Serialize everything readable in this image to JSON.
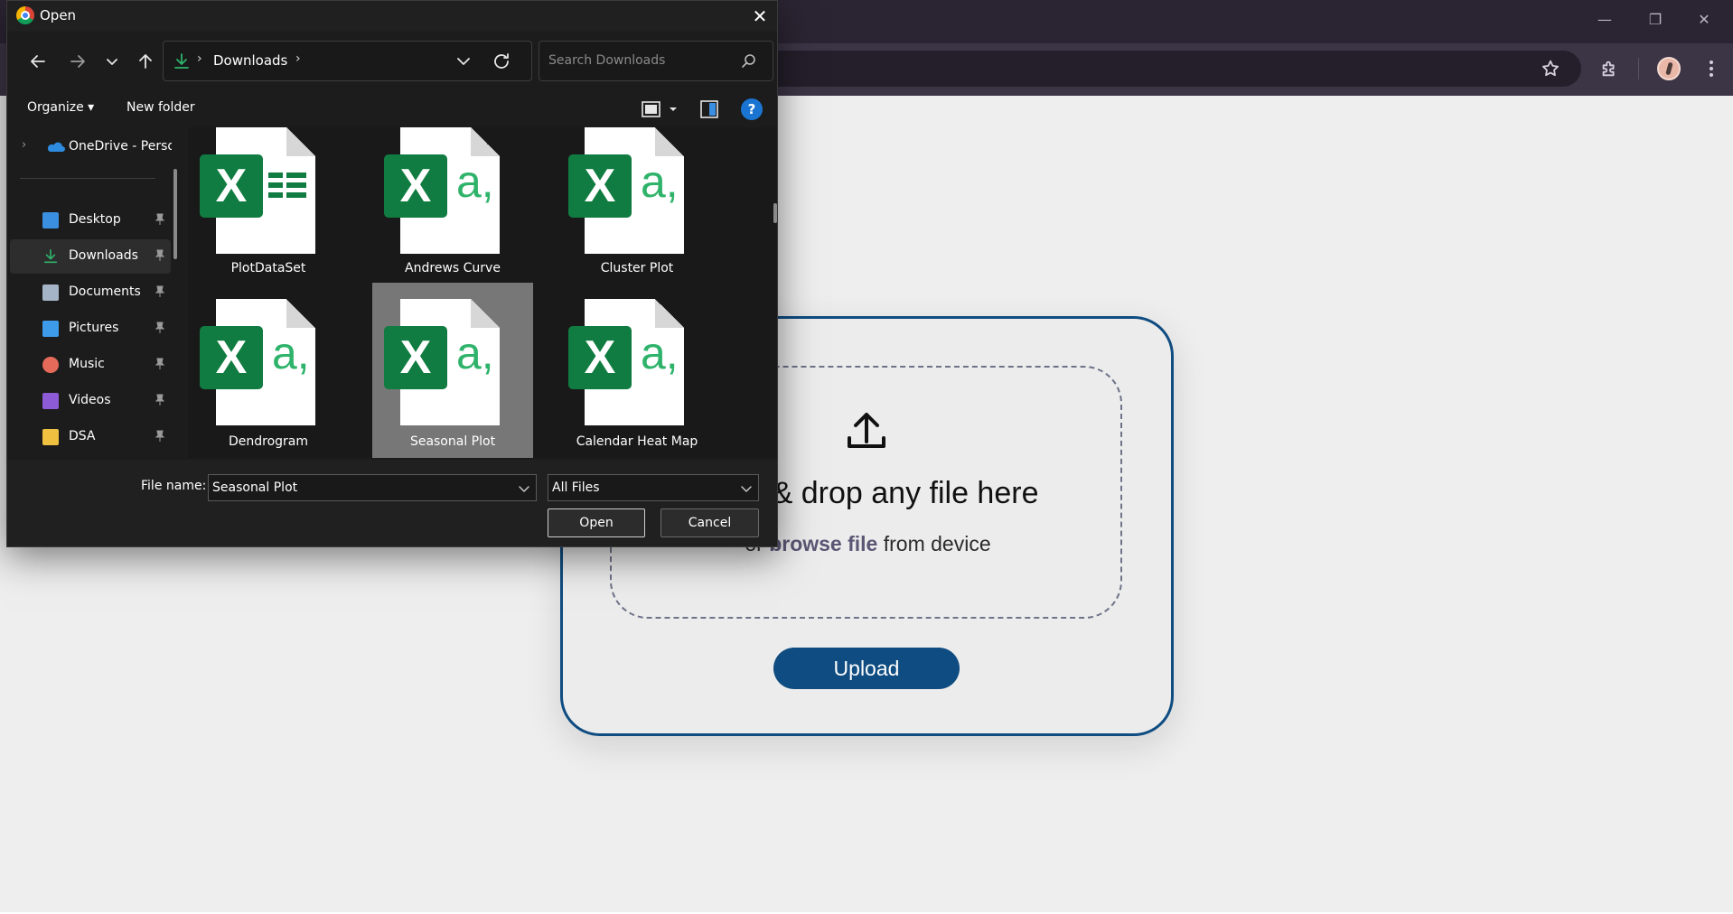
{
  "dialog": {
    "title": "Open",
    "close_glyph": "✕",
    "path": {
      "label": "Downloads",
      "separator": "›"
    },
    "search": {
      "placeholder": "Search Downloads"
    },
    "toolbar": {
      "organize": "Organize ▾",
      "new_folder": "New folder",
      "help": "?"
    },
    "nav_pane": {
      "onedrive": {
        "label": "OneDrive - Personal",
        "chevron": "›"
      },
      "items": [
        {
          "label": "Desktop",
          "icon": "desktop-icon",
          "color": "#3a8fe0",
          "selected": false
        },
        {
          "label": "Downloads",
          "icon": "downloads-icon",
          "color": "#2fb36b",
          "selected": true
        },
        {
          "label": "Documents",
          "icon": "documents-icon",
          "color": "#a6b4c8",
          "selected": false
        },
        {
          "label": "Pictures",
          "icon": "pictures-icon",
          "color": "#3d9be9",
          "selected": false
        },
        {
          "label": "Music",
          "icon": "music-icon",
          "color": "#e66a5a",
          "selected": false
        },
        {
          "label": "Videos",
          "icon": "videos-icon",
          "color": "#8e5bd6",
          "selected": false
        },
        {
          "label": "DSA",
          "icon": "folder-icon",
          "color": "#f0c040",
          "selected": false
        }
      ]
    },
    "files": [
      {
        "name": "PlotDataSet",
        "icon": "excel-spreadsheet-icon",
        "selected": false
      },
      {
        "name": "Andrews Curve",
        "icon": "excel-csv-icon",
        "selected": false
      },
      {
        "name": "Cluster Plot",
        "icon": "excel-csv-icon",
        "selected": false
      },
      {
        "name": "Dendrogram",
        "icon": "excel-csv-icon",
        "selected": false
      },
      {
        "name": "Seasonal Plot",
        "icon": "excel-csv-icon",
        "selected": true
      },
      {
        "name": "Calendar Heat Map",
        "icon": "excel-csv-icon",
        "selected": false
      }
    ],
    "file_icon_text": {
      "x": "X",
      "a": "a,"
    },
    "footer": {
      "filename_label": "File name:",
      "filename_value": "Seasonal Plot",
      "filetype_value": "All Files",
      "open_label": "Open",
      "cancel_label": "Cancel"
    }
  },
  "upload_card": {
    "drop_title": "Drag & drop any file here",
    "browse_prefix": "or ",
    "browse_link": "browse file",
    "browse_suffix": " from device",
    "upload_label": "Upload"
  },
  "browser": {
    "window_controls": {
      "minimize": "—",
      "restore": "❐",
      "close": "✕"
    },
    "colors": {
      "accent": "#0f4c81",
      "excel_green": "#107c41"
    }
  }
}
